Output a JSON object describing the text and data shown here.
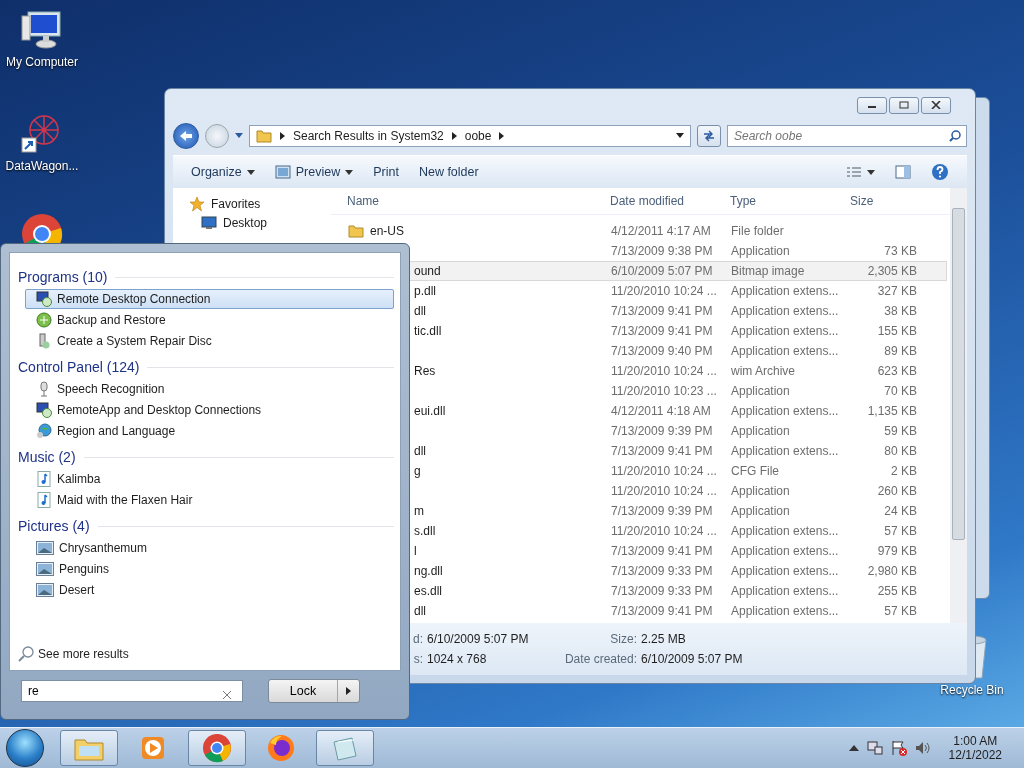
{
  "desktop_icons": [
    {
      "kind": "computer",
      "label": "My Computer"
    },
    {
      "kind": "shortcut",
      "label": "DataWagon..."
    },
    {
      "kind": "chrome"
    },
    {
      "kind": "recycle",
      "label": "Recycle Bin"
    }
  ],
  "explorer": {
    "breadcrumb": [
      "Search Results in System32",
      "oobe"
    ],
    "search_placeholder": "Search oobe",
    "toolbar": [
      {
        "label": "Organize",
        "kind": "menu"
      },
      {
        "label": "Preview",
        "kind": "preview"
      },
      {
        "label": "Print",
        "kind": "command"
      },
      {
        "label": "New folder",
        "kind": "command"
      }
    ],
    "nav": [
      {
        "label": "Favorites",
        "kind": "favorites"
      },
      {
        "label": "Desktop",
        "kind": "desktop"
      }
    ],
    "columns": [
      "Name",
      "Date modified",
      "Type",
      "Size"
    ],
    "files": [
      {
        "kind": "folder",
        "name": "en-US",
        "date": "4/12/2011 4:17 AM",
        "type": "File folder",
        "selected": false
      },
      {
        "kind": "covered",
        "date": "7/13/2009 9:38 PM",
        "type": "Application",
        "size": "73 KB",
        "selected": false
      },
      {
        "kind": "covered",
        "name": "ound",
        "date": "6/10/2009 5:07 PM",
        "type": "Bitmap image",
        "size": "2,305 KB",
        "selected": true
      },
      {
        "kind": "covered",
        "name": "p.dll",
        "date": "11/20/2010 10:24 ...",
        "type": "Application extens...",
        "size": "327 KB",
        "selected": false
      },
      {
        "kind": "covered",
        "name": "dll",
        "date": "7/13/2009 9:41 PM",
        "type": "Application extens...",
        "size": "38 KB",
        "selected": false
      },
      {
        "kind": "covered",
        "name": "tic.dll",
        "date": "7/13/2009 9:41 PM",
        "type": "Application extens...",
        "size": "155 KB",
        "selected": false
      },
      {
        "kind": "covered",
        "date": "7/13/2009 9:40 PM",
        "type": "Application extens...",
        "size": "89 KB",
        "selected": false
      },
      {
        "kind": "covered",
        "name": "Res",
        "date": "11/20/2010 10:24 ...",
        "type": "wim Archive",
        "size": "623 KB",
        "selected": false
      },
      {
        "kind": "covered",
        "date": "11/20/2010 10:23 ...",
        "type": "Application",
        "size": "70 KB",
        "selected": false
      },
      {
        "kind": "covered",
        "name": "eui.dll",
        "date": "4/12/2011 4:18 AM",
        "type": "Application extens...",
        "size": "1,135 KB",
        "selected": false
      },
      {
        "kind": "covered",
        "date": "7/13/2009 9:39 PM",
        "type": "Application",
        "size": "59 KB",
        "selected": false
      },
      {
        "kind": "covered",
        "name": "dll",
        "date": "7/13/2009 9:41 PM",
        "type": "Application extens...",
        "size": "80 KB",
        "selected": false
      },
      {
        "kind": "covered",
        "name": "g",
        "date": "11/20/2010 10:24 ...",
        "type": "CFG File",
        "size": "2 KB",
        "selected": false
      },
      {
        "kind": "covered",
        "date": "11/20/2010 10:24 ...",
        "type": "Application",
        "size": "260 KB",
        "selected": false
      },
      {
        "kind": "covered",
        "name": "m",
        "date": "7/13/2009 9:39 PM",
        "type": "Application",
        "size": "24 KB",
        "selected": false
      },
      {
        "kind": "covered",
        "name": "s.dll",
        "date": "11/20/2010 10:24 ...",
        "type": "Application extens...",
        "size": "57 KB",
        "selected": false
      },
      {
        "kind": "covered",
        "name": "l",
        "date": "7/13/2009 9:41 PM",
        "type": "Application extens...",
        "size": "979 KB",
        "selected": false
      },
      {
        "kind": "covered",
        "name": "ng.dll",
        "date": "7/13/2009 9:33 PM",
        "type": "Application extens...",
        "size": "2,980 KB",
        "selected": false
      },
      {
        "kind": "covered",
        "name": "es.dll",
        "date": "7/13/2009 9:33 PM",
        "type": "Application extens...",
        "size": "255 KB",
        "selected": false
      },
      {
        "kind": "covered",
        "name": "dll",
        "date": "7/13/2009 9:41 PM",
        "type": "Application extens...",
        "size": "57 KB",
        "selected": false
      }
    ],
    "details": [
      {
        "label": "d:",
        "value": "6/10/2009 5:07 PM"
      },
      {
        "label": "Size:",
        "value": "2.25 MB"
      },
      {
        "label": "s:",
        "value": "1024 x 768"
      },
      {
        "label": "Date created:",
        "value": "6/10/2009 5:07 PM"
      }
    ]
  },
  "start_menu": {
    "groups": [
      {
        "title": "Programs (10)",
        "items": [
          {
            "label": "Remote Desktop Connection",
            "kind": "remote",
            "selected": true
          },
          {
            "label": "Backup and Restore",
            "kind": "backup",
            "selected": false
          },
          {
            "label": "Create a System Repair Disc",
            "kind": "repair",
            "selected": false
          }
        ]
      },
      {
        "title": "Control Panel (124)",
        "items": [
          {
            "label": "Speech Recognition",
            "kind": "mic",
            "selected": false
          },
          {
            "label": "RemoteApp and Desktop Connections",
            "kind": "remote",
            "selected": false
          },
          {
            "label": "Region and Language",
            "kind": "globe",
            "selected": false
          }
        ]
      },
      {
        "title": "Music (2)",
        "items": [
          {
            "label": "Kalimba",
            "kind": "music",
            "selected": false
          },
          {
            "label": "Maid with the Flaxen Hair",
            "kind": "music",
            "selected": false
          }
        ]
      },
      {
        "title": "Pictures (4)",
        "items": [
          {
            "label": "Chrysanthemum",
            "kind": "picture",
            "selected": false
          },
          {
            "label": "Penguins",
            "kind": "picture",
            "selected": false
          },
          {
            "label": "Desert",
            "kind": "picture",
            "selected": false
          }
        ]
      }
    ],
    "see_more": "See more results",
    "search_value": "re",
    "lock": "Lock"
  },
  "taskbar": {
    "buttons": [
      {
        "kind": "explorer",
        "running": true
      },
      {
        "kind": "media",
        "running": false
      },
      {
        "kind": "chrome",
        "running": true
      },
      {
        "kind": "firefox",
        "running": false
      },
      {
        "kind": "notepad",
        "running": true
      }
    ],
    "time": "1:00 AM",
    "date": "12/1/2022"
  }
}
